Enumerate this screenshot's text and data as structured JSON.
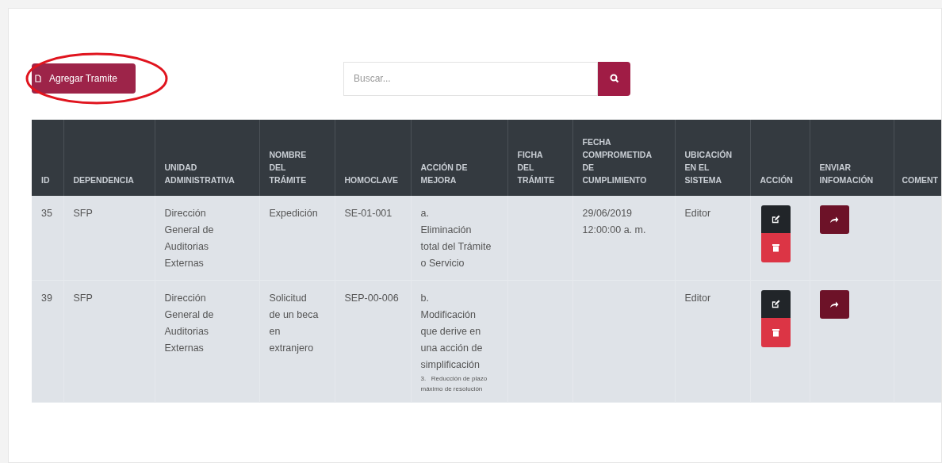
{
  "toolbar": {
    "add_button": "Agregar Tramite",
    "search": {
      "placeholder": "Buscar..."
    }
  },
  "table": {
    "columns": [
      "ID",
      "DEPENDENCIA",
      "UNIDAD ADMINISTRATIVA",
      "NOMBRE DEL TRÁMITE",
      "HOMOCLAVE",
      "ACCIÓN DE MEJORA",
      "FICHA DEL TRÁMITE",
      "FECHA COMPROMETIDA DE CUMPLIMIENTO",
      "UBICACIÓN EN EL SISTEMA",
      "ACCIÓN",
      "ENVIAR INFOMACIÓN",
      "COMENT"
    ],
    "rows": [
      {
        "id": "35",
        "dependencia": "SFP",
        "unidad": "Dirección General de Auditorias Externas",
        "nombre": "Expedición",
        "homoclave": "SE-01-001",
        "accion_mejora": {
          "letter": "a.",
          "text": "Eliminación total del Trámite o Servicio"
        },
        "fecha": "29/06/2019 12:00:00 a. m.",
        "ubicacion": "Editor"
      },
      {
        "id": "39",
        "dependencia": "SFP",
        "unidad": "Dirección General de Auditorias Externas",
        "nombre": "Solicitud de un beca en extranjero",
        "homoclave": "SEP-00-006",
        "accion_mejora": {
          "letter": "b.",
          "text": "Modificación que derive en una acción de simplificación",
          "note": "3.   Reducción de plazo máximo de resolución"
        },
        "ubicacion": "Editor"
      }
    ]
  }
}
